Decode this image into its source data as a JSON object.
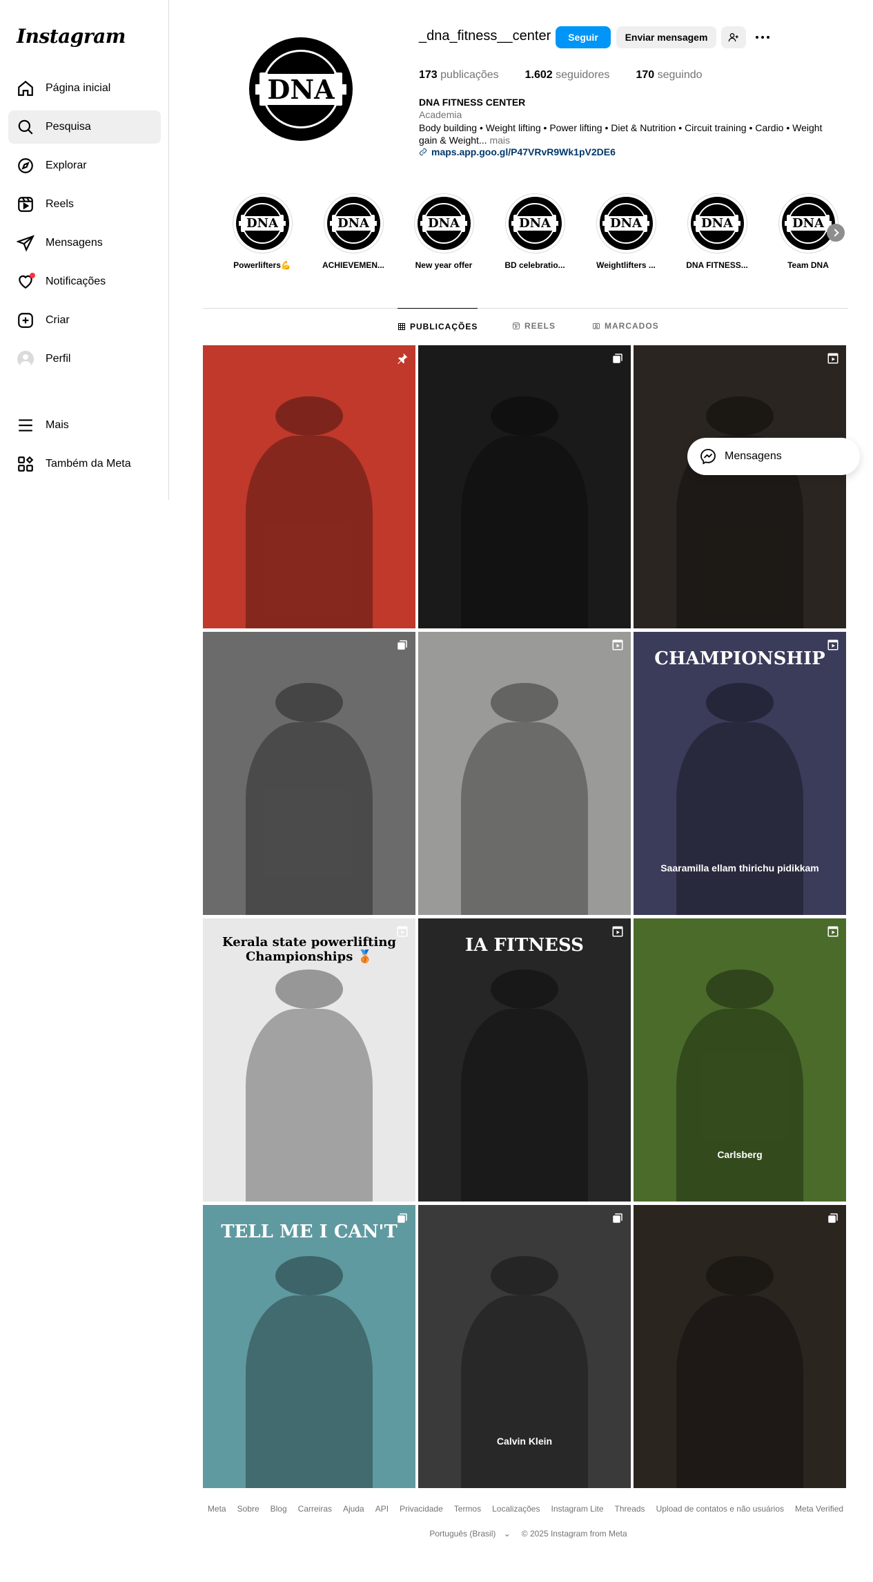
{
  "app": {
    "logo": "Instagram"
  },
  "sidebar": {
    "items": [
      {
        "label": "Página inicial",
        "icon": "home-icon"
      },
      {
        "label": "Pesquisa",
        "icon": "search-icon",
        "active": true
      },
      {
        "label": "Explorar",
        "icon": "compass-icon"
      },
      {
        "label": "Reels",
        "icon": "reels-icon"
      },
      {
        "label": "Mensagens",
        "icon": "send-icon"
      },
      {
        "label": "Notificações",
        "icon": "heart-icon",
        "badge": true
      },
      {
        "label": "Criar",
        "icon": "plus-square-icon"
      },
      {
        "label": "Perfil",
        "icon": "avatar-icon"
      },
      {
        "label": "Mais",
        "icon": "menu-icon"
      },
      {
        "label": "Também da Meta",
        "icon": "meta-apps-icon"
      }
    ]
  },
  "profile": {
    "username": "_dna_fitness__center",
    "follow_label": "Seguir",
    "message_label": "Enviar mensagem",
    "stats": {
      "posts": "173",
      "posts_label": "publicações",
      "followers": "1.602",
      "followers_label": "seguidores",
      "following": "170",
      "following_label": "seguindo"
    },
    "full_name": "DNA FITNESS CENTER",
    "category": "Academia",
    "bio": "Body building • Weight lifting • Power lifting • Diet & Nutrition • Circuit training • Cardio • Weight gain & Weight...",
    "bio_more": "mais",
    "link": "maps.app.goo.gl/P47VRvR9Wk1pV2DE6",
    "logo_text": "DNA"
  },
  "highlights": [
    {
      "label": "Powerlifters💪"
    },
    {
      "label": "ACHIEVEMEN..."
    },
    {
      "label": "New year offer"
    },
    {
      "label": "BD celebratio..."
    },
    {
      "label": "Weightlifters ..."
    },
    {
      "label": "DNA FITNESS..."
    },
    {
      "label": "Team DNA"
    }
  ],
  "tabs": [
    {
      "label": "PUBLICAÇÕES",
      "icon": "grid-icon",
      "active": true
    },
    {
      "label": "REELS",
      "icon": "reels-icon"
    },
    {
      "label": "MARCADOS",
      "icon": "tagged-icon"
    }
  ],
  "posts": [
    {
      "type": "pinned",
      "icon": "pin-icon",
      "bg": "#c0392b"
    },
    {
      "type": "carousel",
      "icon": "carousel-icon",
      "bg": "#1a1a1a"
    },
    {
      "type": "reel",
      "icon": "reel-icon",
      "bg": "#2a2520"
    },
    {
      "type": "carousel",
      "icon": "carousel-icon",
      "bg": "#6b6b6b"
    },
    {
      "type": "reel",
      "icon": "reel-icon",
      "bg": "#9a9a98"
    },
    {
      "type": "reel",
      "icon": "reel-icon",
      "bg": "#3b3b5a",
      "caption": "Saaramilla ellam thirichu pidikkam",
      "title": "CHAMPIONSHIP"
    },
    {
      "type": "reel",
      "icon": "reel-icon",
      "bg": "#e8e8e8",
      "title": "Kerala state powerlifting Championships 🥉"
    },
    {
      "type": "reel",
      "icon": "reel-icon",
      "bg": "#262626",
      "title": "IA FITNESS"
    },
    {
      "type": "reel",
      "icon": "reel-icon",
      "bg": "#4a6b2a",
      "caption": "Carlsberg"
    },
    {
      "type": "carousel",
      "icon": "carousel-icon",
      "bg": "#5f9aa0",
      "title": "TELL ME I CAN'T"
    },
    {
      "type": "carousel",
      "icon": "carousel-icon",
      "bg": "#3a3a3a",
      "caption": "Calvin Klein"
    },
    {
      "type": "carousel",
      "icon": "carousel-icon",
      "bg": "#2b2520"
    }
  ],
  "floating": {
    "label": "Mensagens"
  },
  "footer": {
    "links": [
      "Meta",
      "Sobre",
      "Blog",
      "Carreiras",
      "Ajuda",
      "API",
      "Privacidade",
      "Termos",
      "Localizações",
      "Instagram Lite",
      "Threads",
      "Upload de contatos e não usuários",
      "Meta Verified"
    ],
    "language": "Português (Brasil)",
    "copyright": "© 2025 Instagram from Meta"
  }
}
